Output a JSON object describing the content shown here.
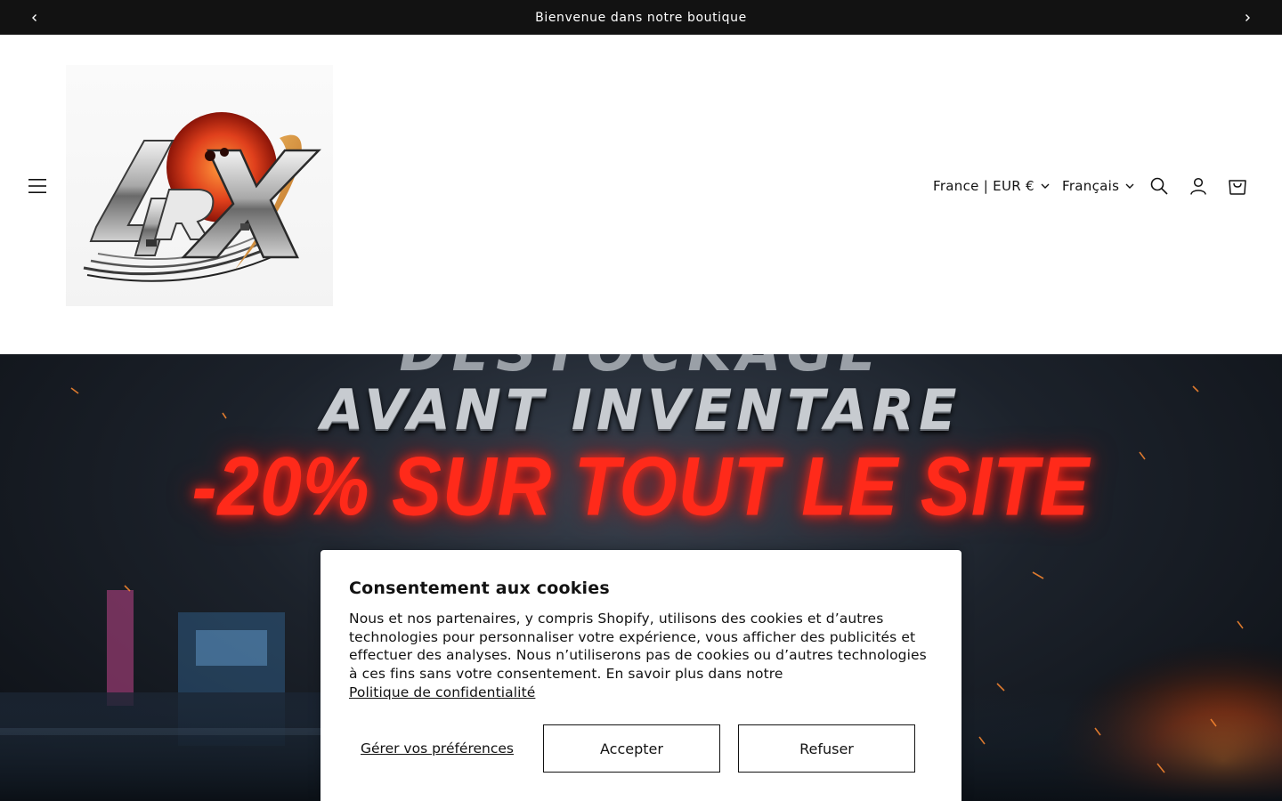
{
  "announcement": {
    "text": "Bienvenue dans notre boutique",
    "prev_icon": "chevron-left-icon",
    "next_icon": "chevron-right-icon"
  },
  "header": {
    "menu_icon": "hamburger-menu-icon",
    "logo_text": "4RX",
    "country_selector": "France | EUR €",
    "language_selector": "Français",
    "icons": [
      "search-icon",
      "account-icon",
      "cart-icon"
    ]
  },
  "hero": {
    "line1": "AVANT INVENTARE",
    "line2": "-20% SUR TOUT LE SITE"
  },
  "cookie_banner": {
    "title": "Consentement aux cookies",
    "body": "Nous et nos partenaires, y compris Shopify, utilisons des cookies et d’autres technologies pour personnaliser votre expérience, vous afficher des publicités et effectuer des analyses. Nous n’utiliserons pas de cookies ou d’autres technologies à ces fins sans votre consentement. En savoir plus dans notre",
    "privacy_link": "Politique de confidentialité",
    "manage_label": "Gérer vos préférences",
    "accept_label": "Accepter",
    "refuse_label": "Refuser"
  },
  "colors": {
    "announcement_bg": "#121212",
    "hero_accent": "#ff2a1a",
    "text": "#121212"
  }
}
